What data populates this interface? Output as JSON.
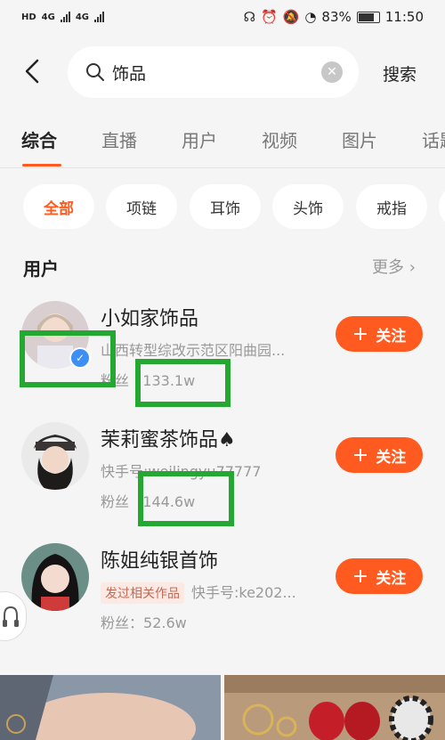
{
  "status_bar": {
    "left_labels": [
      "HD",
      "4G",
      "4G"
    ],
    "battery": "83%",
    "time": "11:50"
  },
  "search": {
    "query": "饰品",
    "submit_label": "搜索"
  },
  "tabs": [
    "综合",
    "直播",
    "用户",
    "视频",
    "图片",
    "话题"
  ],
  "filters": [
    "全部",
    "项链",
    "耳饰",
    "头饰",
    "戒指"
  ],
  "section": {
    "title": "用户",
    "more_label": "更多"
  },
  "users": [
    {
      "name": "小如家饰品",
      "line2": "山西转型综改示范区阳曲园...",
      "fans_label": "粉丝",
      "fans": "133.1w",
      "follow_label": "关注",
      "verified": true
    },
    {
      "name": "茉莉蜜茶饰品♠",
      "line2": "快手号:weilingyu77777",
      "fans_label": "粉丝",
      "fans": "144.6w",
      "follow_label": "关注",
      "verified": false
    },
    {
      "name": "陈姐纯银首饰",
      "tag": "发过相关作品",
      "line2": "快手号:ke202...",
      "fans_label": "粉丝：",
      "fans": "52.6w",
      "follow_label": "关注",
      "verified": false
    }
  ],
  "colors": {
    "accent": "#ff5a1f",
    "highlight": "#25a832",
    "verified": "#3d8ff5"
  }
}
